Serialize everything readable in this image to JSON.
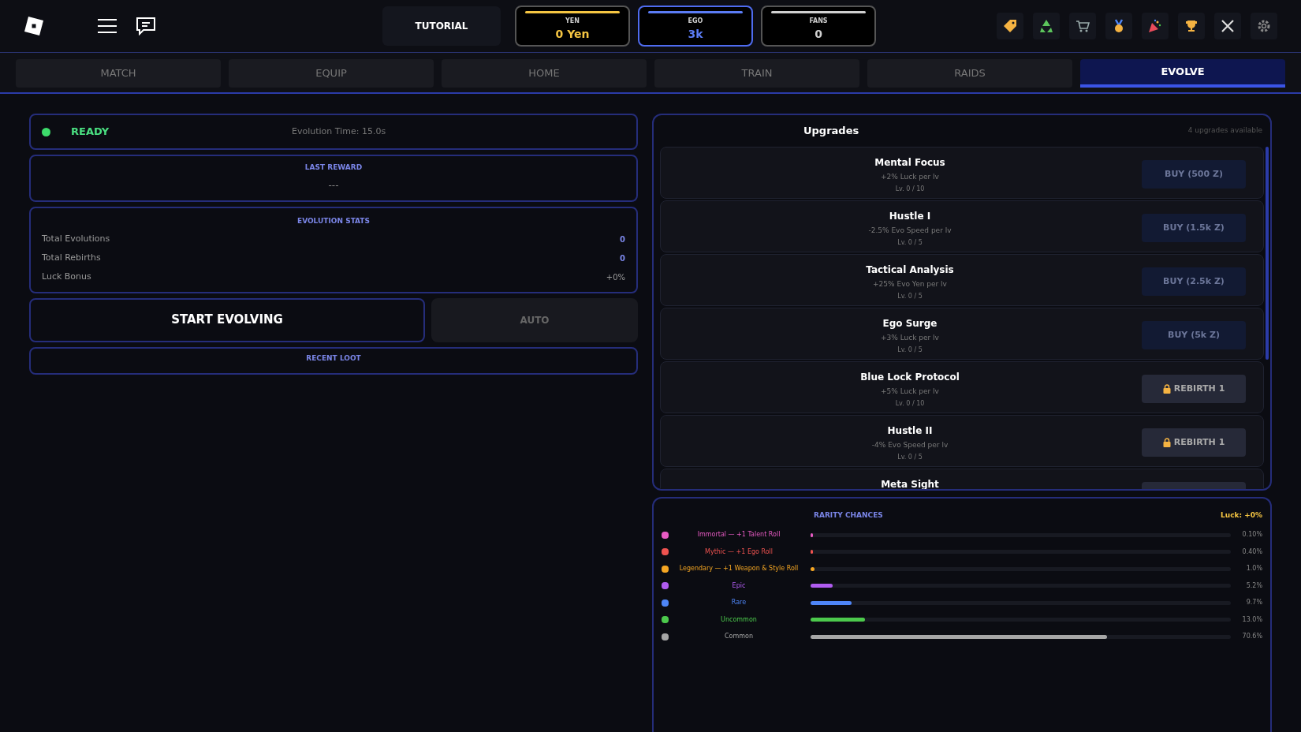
{
  "header": {
    "tutorial": "TUTORIAL",
    "currencies": [
      {
        "label": "YEN",
        "value": "0 Yen",
        "color": "#f5c542",
        "selected": false
      },
      {
        "label": "EGO",
        "value": "3k",
        "color": "#5b7cf5",
        "selected": true
      },
      {
        "label": "FANS",
        "value": "0",
        "color": "#d0d0d0",
        "selected": false
      }
    ]
  },
  "tabs": [
    {
      "label": "MATCH",
      "selected": false
    },
    {
      "label": "EQUIP",
      "selected": false
    },
    {
      "label": "HOME",
      "selected": false
    },
    {
      "label": "TRAIN",
      "selected": false
    },
    {
      "label": "RAIDS",
      "selected": false
    },
    {
      "label": "EVOLVE",
      "selected": true
    }
  ],
  "status": {
    "ready": true,
    "label": "READY",
    "evolution_time": "Evolution Time: 15.0s"
  },
  "last_reward": {
    "title": "LAST REWARD",
    "value": "---"
  },
  "stats": {
    "title": "EVOLUTION STATS",
    "rows": [
      {
        "label": "Total Evolutions",
        "value": "0",
        "kind": "count"
      },
      {
        "label": "Total Rebirths",
        "value": "0",
        "kind": "count"
      },
      {
        "label": "Luck Bonus",
        "value": "+0%",
        "kind": "percent"
      }
    ]
  },
  "start_button": "START EVOLVING",
  "auto_button": {
    "label": "AUTO",
    "on": false
  },
  "recent_loot": {
    "title": "RECENT LOOT"
  },
  "upgrades": {
    "title": "Upgrades",
    "available": "4 upgrades available",
    "items": [
      {
        "name": "Mental Focus",
        "desc": "+2% Luck per lv",
        "level": "Lv. 0 / 10",
        "kind": "buy",
        "button": "BUY (500 Z)"
      },
      {
        "name": "Hustle I",
        "desc": "-2.5% Evo Speed per lv",
        "level": "Lv. 0 / 5",
        "kind": "buy",
        "button": "BUY (1.5k Z)"
      },
      {
        "name": "Tactical Analysis",
        "desc": "+25% Evo Yen per lv",
        "level": "Lv. 0 / 5",
        "kind": "buy",
        "button": "BUY (2.5k Z)"
      },
      {
        "name": "Ego Surge",
        "desc": "+3% Luck per lv",
        "level": "Lv. 0 / 5",
        "kind": "buy",
        "button": "BUY (5k Z)"
      },
      {
        "name": "Blue Lock Protocol",
        "desc": "+5% Luck per lv",
        "level": "Lv. 0 / 10",
        "kind": "locked",
        "button": "REBIRTH 1"
      },
      {
        "name": "Hustle II",
        "desc": "-4% Evo Speed per lv",
        "level": "Lv. 0 / 5",
        "kind": "locked",
        "button": "REBIRTH 1"
      },
      {
        "name": "Meta Sight",
        "kind": "locked"
      }
    ]
  },
  "rarity": {
    "title": "RARITY CHANCES",
    "luck": "Luck: +0%",
    "rows": [
      {
        "name": "Immortal  —  +1 Talent Roll",
        "color": "#e85bc4",
        "level": 0.001,
        "reading": "0.10%"
      },
      {
        "name": "Mythic  —  +1 Ego Roll",
        "color": "#ef5350",
        "level": 0.004,
        "reading": "0.40%"
      },
      {
        "name": "Legendary  —  +1 Weapon & Style Roll",
        "color": "#f5a623",
        "level": 0.01,
        "reading": "1.0%"
      },
      {
        "name": "Epic",
        "color": "#b05cf0",
        "level": 0.052,
        "reading": "5.2%"
      },
      {
        "name": "Rare",
        "color": "#4f86f7",
        "level": 0.097,
        "reading": "9.7%"
      },
      {
        "name": "Uncommon",
        "color": "#4cc94c",
        "level": 0.13,
        "reading": "13.0%"
      },
      {
        "name": "Common",
        "color": "#a6a6a6",
        "level": 0.706,
        "reading": "70.6%"
      }
    ]
  }
}
